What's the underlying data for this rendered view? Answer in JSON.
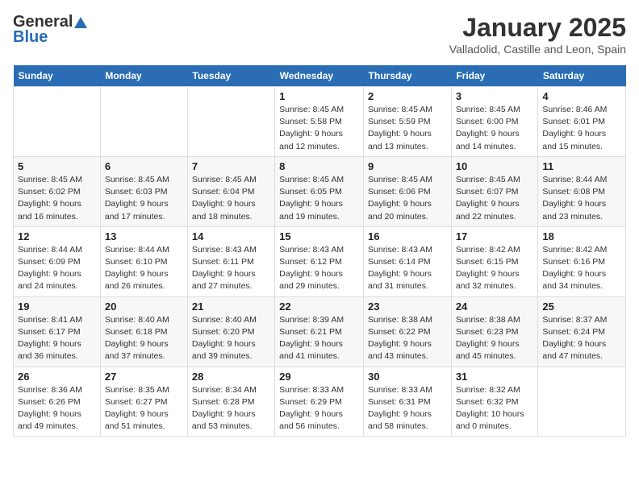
{
  "logo": {
    "general": "General",
    "blue": "Blue"
  },
  "header": {
    "month": "January 2025",
    "location": "Valladolid, Castille and Leon, Spain"
  },
  "weekdays": [
    "Sunday",
    "Monday",
    "Tuesday",
    "Wednesday",
    "Thursday",
    "Friday",
    "Saturday"
  ],
  "weeks": [
    [
      {
        "day": "",
        "info": ""
      },
      {
        "day": "",
        "info": ""
      },
      {
        "day": "",
        "info": ""
      },
      {
        "day": "1",
        "info": "Sunrise: 8:45 AM\nSunset: 5:58 PM\nDaylight: 9 hours and 12 minutes."
      },
      {
        "day": "2",
        "info": "Sunrise: 8:45 AM\nSunset: 5:59 PM\nDaylight: 9 hours and 13 minutes."
      },
      {
        "day": "3",
        "info": "Sunrise: 8:45 AM\nSunset: 6:00 PM\nDaylight: 9 hours and 14 minutes."
      },
      {
        "day": "4",
        "info": "Sunrise: 8:46 AM\nSunset: 6:01 PM\nDaylight: 9 hours and 15 minutes."
      }
    ],
    [
      {
        "day": "5",
        "info": "Sunrise: 8:45 AM\nSunset: 6:02 PM\nDaylight: 9 hours and 16 minutes."
      },
      {
        "day": "6",
        "info": "Sunrise: 8:45 AM\nSunset: 6:03 PM\nDaylight: 9 hours and 17 minutes."
      },
      {
        "day": "7",
        "info": "Sunrise: 8:45 AM\nSunset: 6:04 PM\nDaylight: 9 hours and 18 minutes."
      },
      {
        "day": "8",
        "info": "Sunrise: 8:45 AM\nSunset: 6:05 PM\nDaylight: 9 hours and 19 minutes."
      },
      {
        "day": "9",
        "info": "Sunrise: 8:45 AM\nSunset: 6:06 PM\nDaylight: 9 hours and 20 minutes."
      },
      {
        "day": "10",
        "info": "Sunrise: 8:45 AM\nSunset: 6:07 PM\nDaylight: 9 hours and 22 minutes."
      },
      {
        "day": "11",
        "info": "Sunrise: 8:44 AM\nSunset: 6:08 PM\nDaylight: 9 hours and 23 minutes."
      }
    ],
    [
      {
        "day": "12",
        "info": "Sunrise: 8:44 AM\nSunset: 6:09 PM\nDaylight: 9 hours and 24 minutes."
      },
      {
        "day": "13",
        "info": "Sunrise: 8:44 AM\nSunset: 6:10 PM\nDaylight: 9 hours and 26 minutes."
      },
      {
        "day": "14",
        "info": "Sunrise: 8:43 AM\nSunset: 6:11 PM\nDaylight: 9 hours and 27 minutes."
      },
      {
        "day": "15",
        "info": "Sunrise: 8:43 AM\nSunset: 6:12 PM\nDaylight: 9 hours and 29 minutes."
      },
      {
        "day": "16",
        "info": "Sunrise: 8:43 AM\nSunset: 6:14 PM\nDaylight: 9 hours and 31 minutes."
      },
      {
        "day": "17",
        "info": "Sunrise: 8:42 AM\nSunset: 6:15 PM\nDaylight: 9 hours and 32 minutes."
      },
      {
        "day": "18",
        "info": "Sunrise: 8:42 AM\nSunset: 6:16 PM\nDaylight: 9 hours and 34 minutes."
      }
    ],
    [
      {
        "day": "19",
        "info": "Sunrise: 8:41 AM\nSunset: 6:17 PM\nDaylight: 9 hours and 36 minutes."
      },
      {
        "day": "20",
        "info": "Sunrise: 8:40 AM\nSunset: 6:18 PM\nDaylight: 9 hours and 37 minutes."
      },
      {
        "day": "21",
        "info": "Sunrise: 8:40 AM\nSunset: 6:20 PM\nDaylight: 9 hours and 39 minutes."
      },
      {
        "day": "22",
        "info": "Sunrise: 8:39 AM\nSunset: 6:21 PM\nDaylight: 9 hours and 41 minutes."
      },
      {
        "day": "23",
        "info": "Sunrise: 8:38 AM\nSunset: 6:22 PM\nDaylight: 9 hours and 43 minutes."
      },
      {
        "day": "24",
        "info": "Sunrise: 8:38 AM\nSunset: 6:23 PM\nDaylight: 9 hours and 45 minutes."
      },
      {
        "day": "25",
        "info": "Sunrise: 8:37 AM\nSunset: 6:24 PM\nDaylight: 9 hours and 47 minutes."
      }
    ],
    [
      {
        "day": "26",
        "info": "Sunrise: 8:36 AM\nSunset: 6:26 PM\nDaylight: 9 hours and 49 minutes."
      },
      {
        "day": "27",
        "info": "Sunrise: 8:35 AM\nSunset: 6:27 PM\nDaylight: 9 hours and 51 minutes."
      },
      {
        "day": "28",
        "info": "Sunrise: 8:34 AM\nSunset: 6:28 PM\nDaylight: 9 hours and 53 minutes."
      },
      {
        "day": "29",
        "info": "Sunrise: 8:33 AM\nSunset: 6:29 PM\nDaylight: 9 hours and 56 minutes."
      },
      {
        "day": "30",
        "info": "Sunrise: 8:33 AM\nSunset: 6:31 PM\nDaylight: 9 hours and 58 minutes."
      },
      {
        "day": "31",
        "info": "Sunrise: 8:32 AM\nSunset: 6:32 PM\nDaylight: 10 hours and 0 minutes."
      },
      {
        "day": "",
        "info": ""
      }
    ]
  ]
}
